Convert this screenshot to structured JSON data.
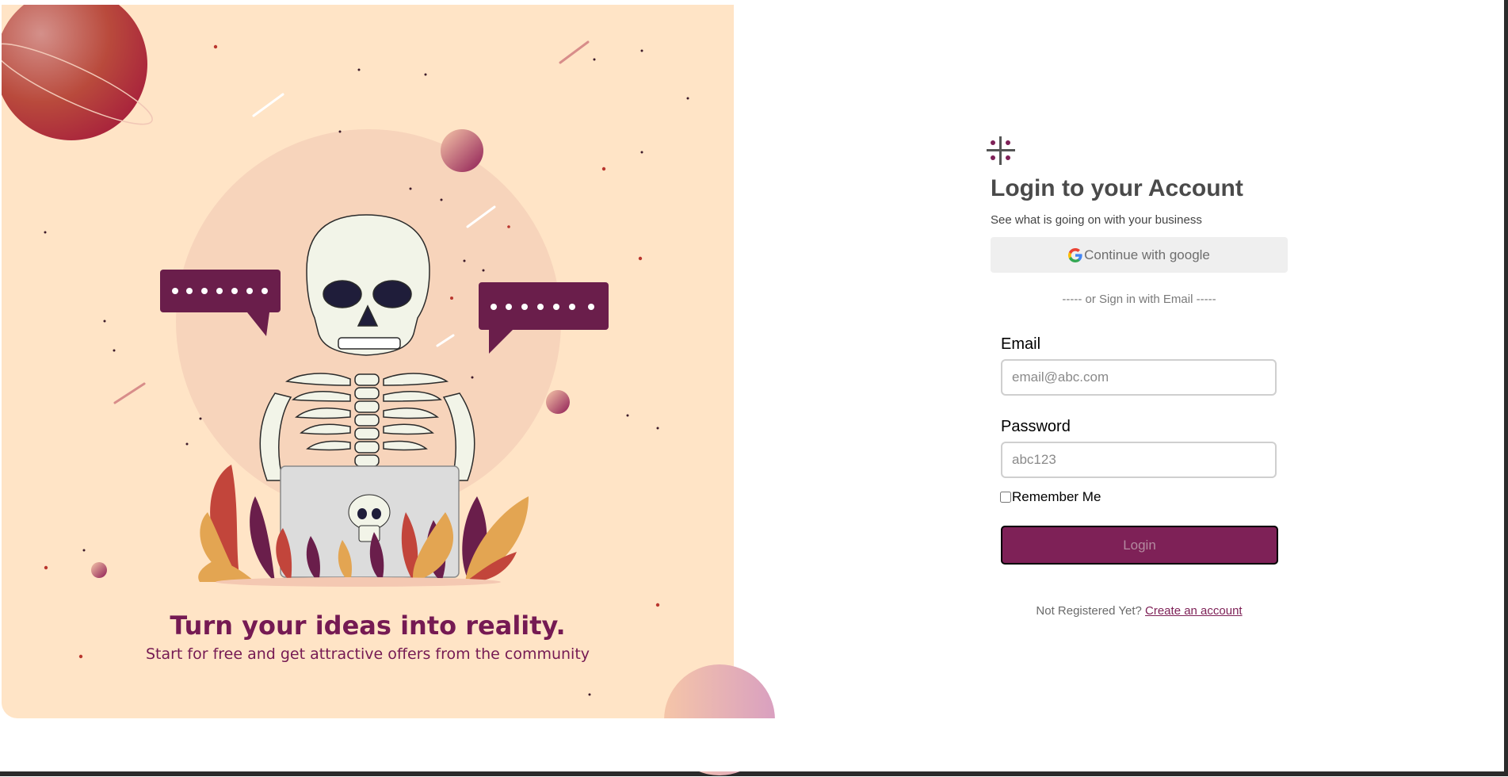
{
  "hero": {
    "headline": "Turn your ideas into reality.",
    "subheadline": "Start for free and get attractive offers from the community",
    "bubble_text": "•••••••"
  },
  "login": {
    "title": "Login to your Account",
    "subtitle": "See what is going on with your business",
    "google_label": "Continue with google",
    "divider": "----- or Sign in with Email -----",
    "email_label": "Email",
    "email_placeholder": "email@abc.com",
    "password_label": "Password",
    "password_placeholder": "abc123",
    "remember_label": "Remember Me",
    "login_label": "Login",
    "register_prompt": "Not Registered Yet?",
    "register_link": "Create an account"
  },
  "colors": {
    "brand": "#7e2157",
    "hero_bg": "#ffe4c6",
    "hero_text": "#751a53"
  },
  "icons": [
    "app-logo-icon",
    "google-icon"
  ]
}
